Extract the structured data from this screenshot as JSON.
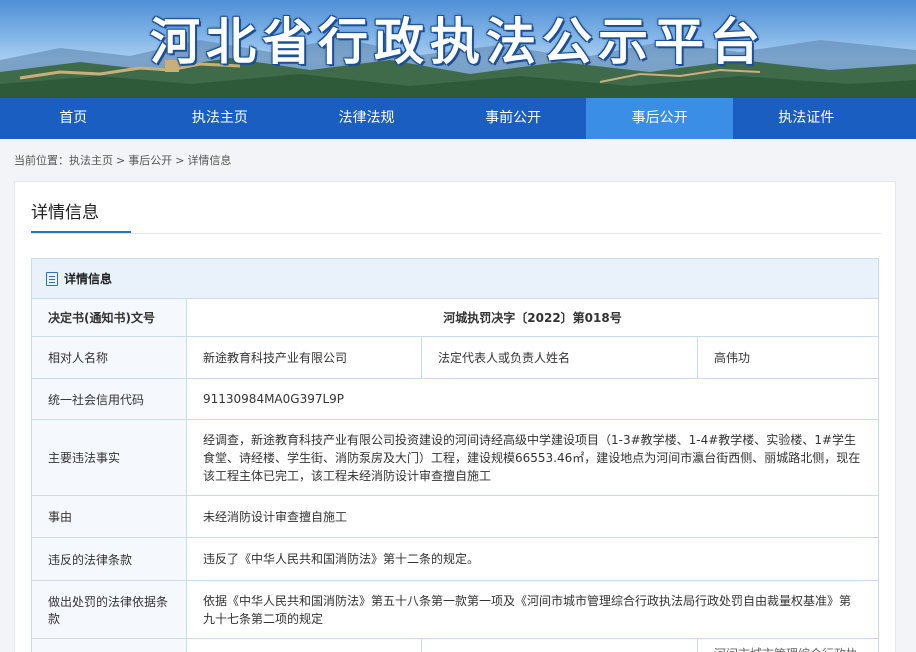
{
  "banner": {
    "title": "河北省行政执法公示平台"
  },
  "nav": {
    "items": [
      {
        "label": "首页"
      },
      {
        "label": "执法主页"
      },
      {
        "label": "法律法规"
      },
      {
        "label": "事前公开"
      },
      {
        "label": "事后公开",
        "active": true
      },
      {
        "label": "执法证件"
      }
    ]
  },
  "breadcrumb": {
    "prefix": "当前位置：",
    "items": [
      "执法主页",
      "事后公开",
      "详情信息"
    ],
    "separator": ">"
  },
  "panel": {
    "title": "详情信息"
  },
  "detail": {
    "header": "详情信息",
    "rows": {
      "doc_no": {
        "label": "决定书(通知书)文号",
        "value": "河城执罚决字〔2022〕第018号"
      },
      "party": {
        "label": "相对人名称",
        "value": "新途教育科技产业有限公司",
        "rep_label": "法定代表人或负责人姓名",
        "rep_value": "高伟功"
      },
      "credit_code": {
        "label": "统一社会信用代码",
        "value": "91130984MA0G397L9P"
      },
      "facts": {
        "label": "主要违法事实",
        "value": "经调查，新途教育科技产业有限公司投资建设的河间诗经高级中学建设项目（1-3#教学楼、1-4#教学楼、实验楼、1#学生食堂、诗经楼、学生街、消防泵房及大门）工程，建设规模66553.46㎡，建设地点为河间市瀛台街西侧、丽城路北侧，现在该工程主体已完工，该工程未经消防设计审查擅自施工"
      },
      "cause": {
        "label": "事由",
        "value": "未经消防设计审查擅自施工"
      },
      "violated": {
        "label": "违反的法律条款",
        "value": "违反了《中华人民共和国消防法》第十二条的规定。"
      },
      "basis": {
        "label": "做出处罚的法律依据条款",
        "value": "依据《中华人民共和国消防法》第五十八条第一款第一项及《河间市城市管理综合行政执法局行政处罚自由裁量权基准》第九十七条第二项的规定"
      },
      "partial": {
        "value": "河间市城市管理综合行政执法"
      }
    }
  },
  "colors": {
    "nav": "#1a5ec2",
    "nav_active": "#3b8ee6",
    "table_border": "#c9dbee",
    "header_bg": "#e9f2fb"
  }
}
